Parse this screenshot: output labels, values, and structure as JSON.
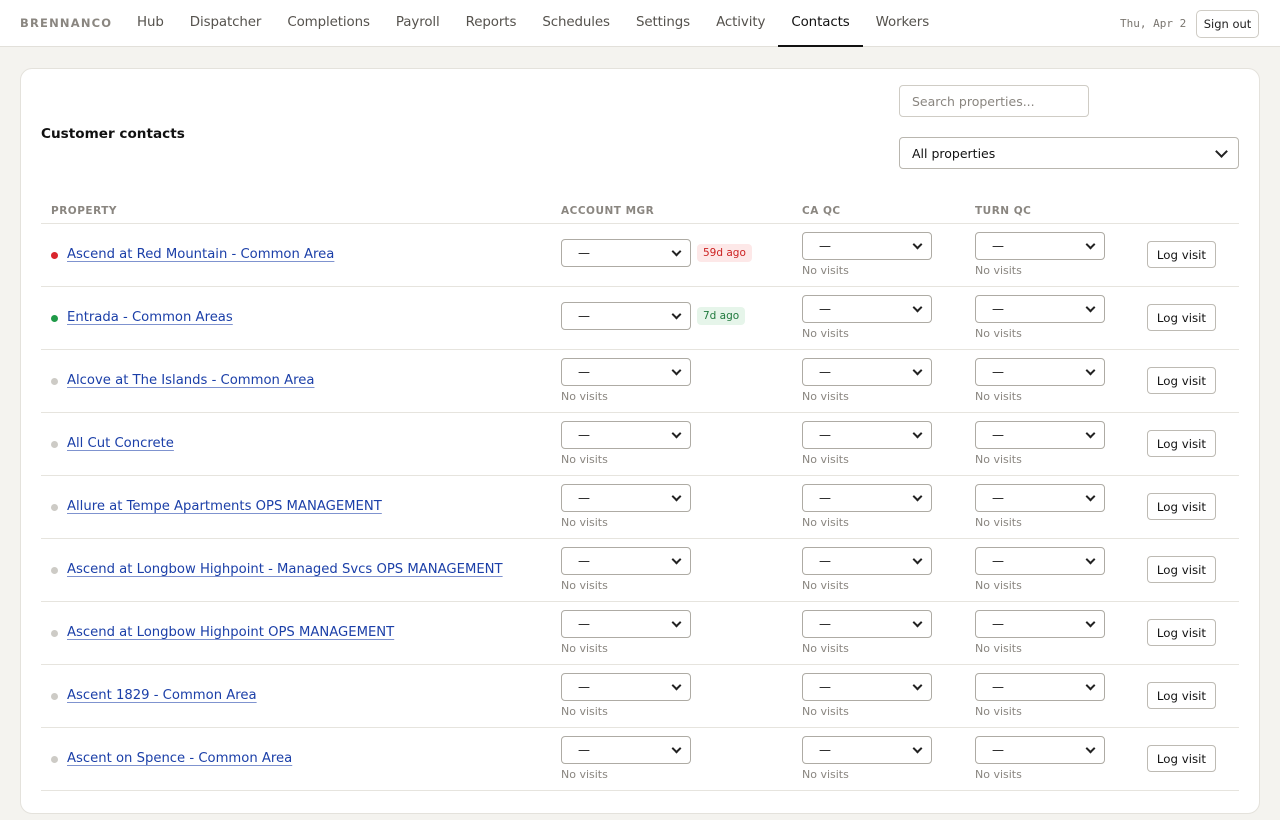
{
  "brand": "BRENNANCO",
  "nav": [
    "Hub",
    "Dispatcher",
    "Completions",
    "Payroll",
    "Reports",
    "Schedules",
    "Settings",
    "Activity",
    "Contacts",
    "Workers"
  ],
  "nav_active": "Contacts",
  "date": "Thu, Apr 2",
  "sign_out": "Sign out",
  "card": {
    "title": "Customer contacts",
    "search_placeholder": "Search properties...",
    "filter_value": "All properties"
  },
  "columns": {
    "property": "PROPERTY",
    "account_mgr": "ACCOUNT MGR",
    "ca_qc": "CA QC",
    "turn_qc": "TURN QC"
  },
  "select_empty": "—",
  "no_visits": "No visits",
  "log_visit": "Log visit",
  "colors": {
    "status_red": "#d9262d",
    "status_green": "#1f9a48",
    "status_grey": "#cdcbc6",
    "link": "#1b3fa8"
  },
  "rows": [
    {
      "property": "Ascend at Red Mountain - Common Area",
      "status": "red",
      "account_mgr_badge": "59d ago"
    },
    {
      "property": "Entrada - Common Areas",
      "status": "green",
      "account_mgr_badge": "7d ago"
    },
    {
      "property": "Alcove at The Islands - Common Area",
      "status": "grey",
      "account_mgr_badge": ""
    },
    {
      "property": "All Cut Concrete",
      "status": "grey",
      "account_mgr_badge": ""
    },
    {
      "property": "Allure at Tempe Apartments OPS MANAGEMENT",
      "status": "grey",
      "account_mgr_badge": ""
    },
    {
      "property": "Ascend at Longbow Highpoint - Managed Svcs OPS MANAGEMENT",
      "status": "grey",
      "account_mgr_badge": ""
    },
    {
      "property": "Ascend at Longbow Highpoint OPS MANAGEMENT",
      "status": "grey",
      "account_mgr_badge": ""
    },
    {
      "property": "Ascent 1829 - Common Area",
      "status": "grey",
      "account_mgr_badge": ""
    },
    {
      "property": "Ascent on Spence - Common Area",
      "status": "grey",
      "account_mgr_badge": ""
    }
  ]
}
